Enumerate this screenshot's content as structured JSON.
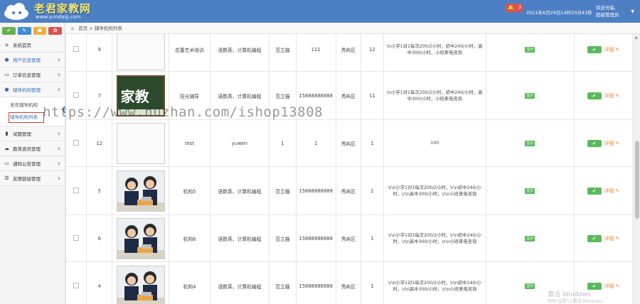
{
  "header": {
    "site_title": "老君家教网",
    "site_url": "www.yundaijj.com",
    "notification_label": "🔔",
    "notification_count": "3",
    "datetime": "2021年6月29日14时20分41秒",
    "user_greeting": "欢迎光临,",
    "user_role": "超级管理员"
  },
  "sidebar": {
    "shortcuts": [
      {
        "icon": "chart-icon",
        "glyph": "✔"
      },
      {
        "icon": "pencil-icon",
        "glyph": "✎"
      },
      {
        "icon": "users-icon",
        "glyph": "☗"
      },
      {
        "icon": "cogs-icon",
        "glyph": "✿"
      }
    ],
    "items": [
      {
        "label": "系统首页",
        "icon": "home-icon",
        "glyph": "⌂"
      },
      {
        "label": "用户信息管理",
        "icon": "user-icon",
        "glyph": "●"
      },
      {
        "label": "订单信息管理",
        "icon": "credit-card-icon",
        "glyph": "▭"
      },
      {
        "label": "辅导机构管理",
        "icon": "user-icon",
        "glyph": "●"
      },
      {
        "label": "试题管理",
        "icon": "bookmark-icon",
        "glyph": "▮"
      },
      {
        "label": "教育资讯管理",
        "icon": "comments-icon",
        "glyph": "☁"
      },
      {
        "label": "通知公告管理",
        "icon": "desktop-icon",
        "glyph": "▭"
      },
      {
        "label": "友情链接管理",
        "icon": "tasks-icon",
        "glyph": "☰"
      }
    ],
    "subitems": [
      {
        "label": "发布辅导机构"
      },
      {
        "label": "辅导机构列表"
      }
    ]
  },
  "breadcrumb": {
    "home": "首页",
    "current": "辅导机构列表"
  },
  "table": {
    "rows": [
      {
        "id": "9",
        "pic": "broken",
        "name": "花蕾艺术培训",
        "subjects": "语数英、计算机编程",
        "address": "范立猫",
        "tel": "111",
        "area": "秀屿区",
        "num": "12",
        "desc": "\\n小学1对1每次200/2小时，初中240/小时，高中300/小时，小班来电咨询",
        "status": "显示"
      },
      {
        "id": "7",
        "pic": "jiajiao",
        "name": "阳光辅导",
        "subjects": "语数英、计算机编程",
        "address": "范立猫",
        "tel": "15888888888",
        "area": "秀屿区",
        "num": "11",
        "desc": "\\n小学1对1每次200/2小时，初中240/小时，高中300/小时，小班来电咨询",
        "status": "显示"
      },
      {
        "id": "12",
        "pic": "broken",
        "name": "test",
        "subjects": "yuwen",
        "address": "1",
        "tel": "1",
        "area": "秀屿区",
        "num": "1",
        "desc": "100",
        "status": "显示"
      },
      {
        "id": "5",
        "pic": "photo",
        "name": "机构5",
        "subjects": "语数英、计算机编程",
        "address": "范立猫",
        "tel": "15888888888",
        "area": "秀屿区",
        "num": "1",
        "desc": "\\r\\n小学1对1每次200/2小时，\\r\\n初中240/小时，\\r\\n高中300/小时，\\r\\n小班来电咨询",
        "status": "显示"
      },
      {
        "id": "6",
        "pic": "photo",
        "name": "机构6",
        "subjects": "语数英、计算机编程",
        "address": "范立猫",
        "tel": "15888888888",
        "area": "秀屿区",
        "num": "1",
        "desc": "\\r\\n小学1对1每次200/2小时，\\r\\n初中240/小时，\\r\\n高中300/小时，\\r\\n小班来电咨询",
        "status": "显示"
      },
      {
        "id": "4",
        "pic": "photo",
        "name": "机构4",
        "subjects": "语数英、计算机编程",
        "address": "范立猫",
        "tel": "15888888888",
        "area": "秀屿区",
        "num": "1",
        "desc": "\\r\\n小学1对1每次200/2小时，\\r\\n初中240/小时，\\r\\n高中300/小时，\\r\\n小班来电咨询",
        "status": "显示"
      }
    ],
    "ok_glyph": "✔",
    "detail_label": "详细",
    "edit_glyph": "✎",
    "jiajiao_text": "家教"
  },
  "overlays": {
    "watermark": "https://www.huzhan.com/ishop13808",
    "activate_title": "激活 Windows",
    "activate_sub": "转到\"设置\"以激活 Windows。"
  },
  "colors": {
    "header_bg": "#4d7fc5",
    "status_green": "#5cb85c",
    "detail_orange": "#f0883a",
    "active_box": "#e3342f"
  }
}
